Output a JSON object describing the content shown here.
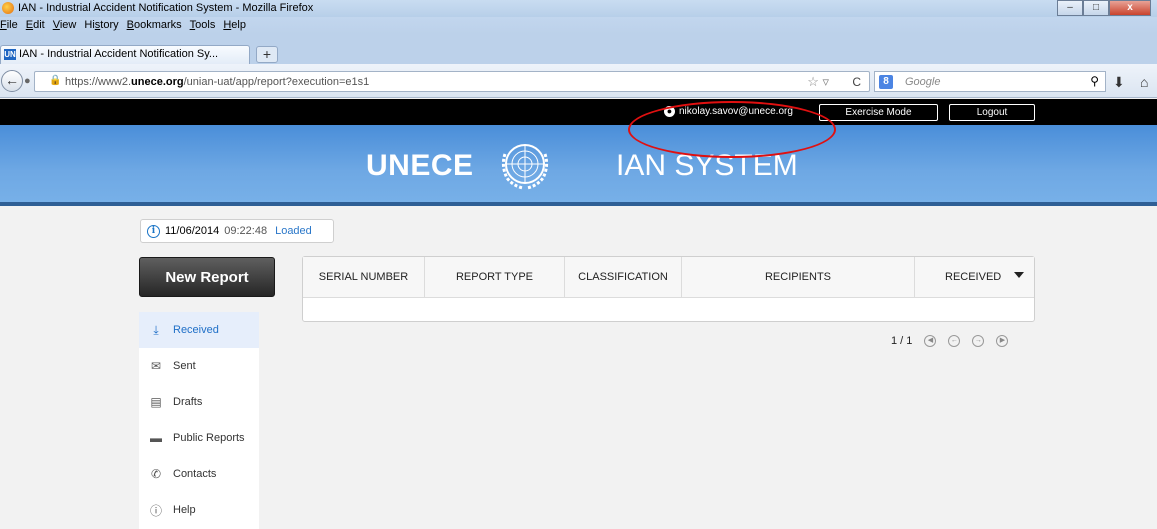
{
  "browser": {
    "window_title": "IAN - Industrial Accident Notification System - Mozilla Firefox",
    "menu": [
      {
        "label": "File",
        "hotkey_first": "F"
      },
      {
        "label": "Edit"
      },
      {
        "label": "View"
      },
      {
        "label": "History"
      },
      {
        "label": "Bookmarks"
      },
      {
        "label": "Tools"
      },
      {
        "label": "Help"
      }
    ],
    "tab_title": "IAN - Industrial Accident Notification Sy...",
    "tab_favicon": "UN",
    "url_prefix": "https://www2.",
    "url_domain": "unece.org",
    "url_path": "/unian-uat/app/report?execution=e1s1",
    "search_engine": "8",
    "search_placeholder": "Google"
  },
  "header": {
    "user_email": "nikolay.savov@unece.org",
    "exercise_mode_label": "Exercise Mode",
    "logout_label": "Logout",
    "brand_left": "UNECE",
    "brand_right": "IAN SYSTEM",
    "highlight_color": "#e01010"
  },
  "status": {
    "date": "11/06/2014",
    "time": "09:22:48",
    "state": "Loaded"
  },
  "new_report_label": "New Report",
  "sidebar": {
    "items": [
      {
        "label": "Received",
        "icon": "download-icon",
        "active": true
      },
      {
        "label": "Sent",
        "icon": "envelope-icon",
        "active": false
      },
      {
        "label": "Drafts",
        "icon": "document-icon",
        "active": false
      },
      {
        "label": "Public Reports",
        "icon": "folder-icon",
        "active": false
      },
      {
        "label": "Contacts",
        "icon": "phone-icon",
        "active": false
      },
      {
        "label": "Help",
        "icon": "info-icon",
        "active": false
      }
    ]
  },
  "table": {
    "columns": [
      "SERIAL NUMBER",
      "REPORT TYPE",
      "CLASSIFICATION",
      "RECIPIENTS",
      "RECEIVED"
    ]
  },
  "pagination": {
    "page_text": "1 / 1"
  }
}
